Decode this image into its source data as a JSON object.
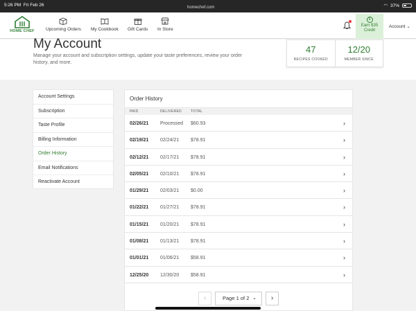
{
  "status_bar": {
    "time": "5:26 PM",
    "date": "Fri Feb 26",
    "url": "homechef.com",
    "battery": "37%"
  },
  "nav": {
    "logo_text": "HOME CHEF",
    "items": [
      {
        "label": "Upcoming Orders",
        "icon": "box-icon"
      },
      {
        "label": "My Cookbook",
        "icon": "book-icon"
      },
      {
        "label": "Gift Cards",
        "icon": "gift-icon"
      },
      {
        "label": "In Store",
        "icon": "store-icon"
      }
    ],
    "earn": {
      "symbol": "$",
      "line1": "Earn $35",
      "line2": "Credit"
    },
    "account_label": "Account"
  },
  "header": {
    "title": "My Account",
    "description": "Manage your account and subscription settings, update your taste preferences, review your order history, and more.",
    "stats": [
      {
        "value": "47",
        "label": "RECIPES COOKED"
      },
      {
        "value": "12/20",
        "label": "MEMBER SINCE"
      }
    ]
  },
  "side_menu": [
    "Account Settings",
    "Subscription",
    "Taste Profile",
    "Billing Information",
    "Order History",
    "Email Notifications",
    "Reactivate Account"
  ],
  "active_menu_index": 4,
  "order_history": {
    "title": "Order History",
    "columns": [
      "PAID",
      "DELIVERED",
      "TOTAL"
    ],
    "rows": [
      {
        "paid": "02/26/21",
        "delivered": "Processed",
        "total": "$60.93"
      },
      {
        "paid": "02/19/21",
        "delivered": "02/24/21",
        "total": "$78.91"
      },
      {
        "paid": "02/12/21",
        "delivered": "02/17/21",
        "total": "$78.91"
      },
      {
        "paid": "02/05/21",
        "delivered": "02/10/21",
        "total": "$78.91"
      },
      {
        "paid": "01/29/21",
        "delivered": "02/03/21",
        "total": "$0.00"
      },
      {
        "paid": "01/22/21",
        "delivered": "01/27/21",
        "total": "$78.91"
      },
      {
        "paid": "01/15/21",
        "delivered": "01/20/21",
        "total": "$78.91"
      },
      {
        "paid": "01/08/21",
        "delivered": "01/13/21",
        "total": "$78.91"
      },
      {
        "paid": "01/01/21",
        "delivered": "01/06/21",
        "total": "$58.91"
      },
      {
        "paid": "12/25/20",
        "delivered": "12/30/20",
        "total": "$58.91"
      }
    ]
  },
  "pagination": {
    "label": "Page 1 of 2",
    "prev": "‹",
    "next": "›"
  },
  "colors": {
    "brand_green": "#2f7d32",
    "credit_bg": "#dbf0d8",
    "notification_dot": "#e53935"
  }
}
